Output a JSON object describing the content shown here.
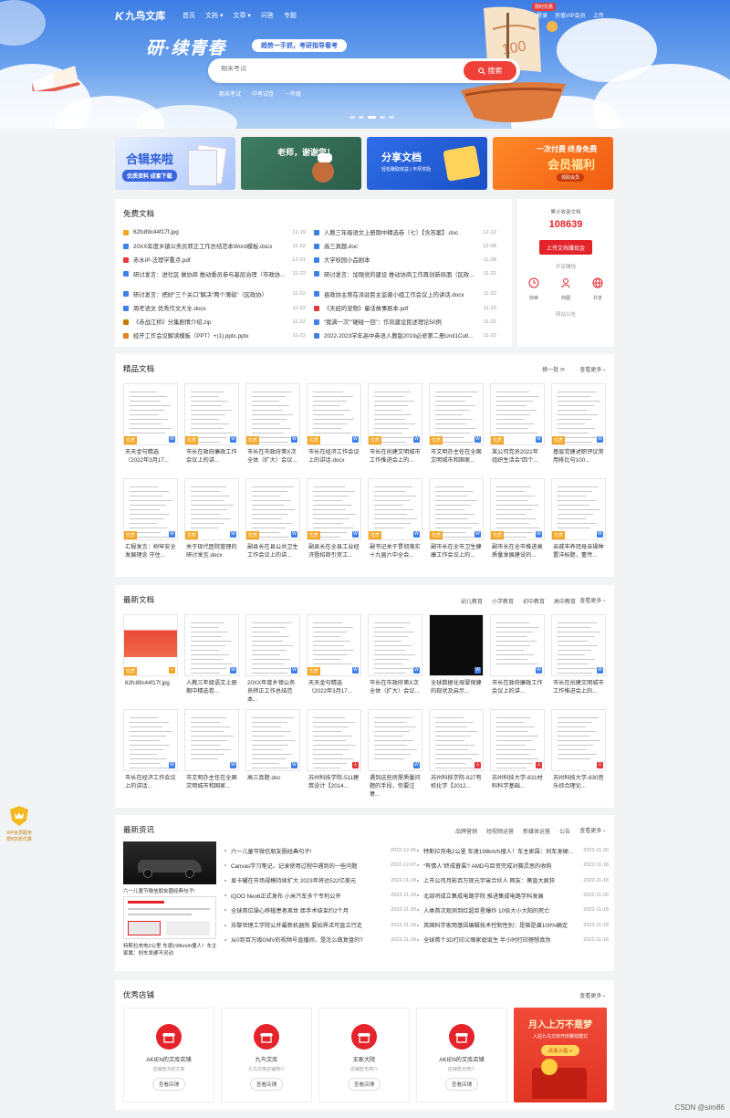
{
  "colors": {
    "accent": "#ef4138",
    "brand": "#3d7de4",
    "tag": "#f5a623"
  },
  "nav": {
    "logo": "九鸟文库",
    "links": [
      "首页",
      "文档 ▾",
      "文章 ▾",
      "问答",
      "专题"
    ],
    "vip_badge": "限时优惠",
    "right": [
      "登录",
      "充值VIP会员",
      "上传"
    ]
  },
  "hero": {
    "slogan": "研·续青春",
    "slogan2": "趋势一手抓，考研指导看考",
    "search_placeholder": "期末考试",
    "search_button": "搜索",
    "hotwords": [
      "期末考试",
      "中考试卷",
      "一年级"
    ]
  },
  "banners": [
    {
      "title": "合辑来啦",
      "sub": "优质资料 成套下载"
    },
    {
      "title": "老师，谢谢您！",
      "sub": ""
    },
    {
      "title": "分享文档",
      "sub": "轻松赚取收益 | 丰厚奖励"
    },
    {
      "title": "一次付费 终身免费",
      "sub": "会员福利",
      "btn": "领取会员"
    }
  ],
  "free": {
    "title": "免费文档",
    "left": [
      {
        "n": "62fc89c44f17f.jpg",
        "d": "12-19",
        "c": "#f5a623"
      },
      {
        "n": "20XX年度乡镇公务员转正工作总结范本Word模板.docx",
        "d": "11-22",
        "c": "#3f7fe8"
      },
      {
        "n": "赤水IP-法理学重点.pdf",
        "d": "12-01",
        "c": "#e4383b"
      },
      {
        "n": "研讨发言：进社区 做协商 推动委员参与基层治理（市政协...",
        "d": "11-22",
        "c": "#3f7fe8"
      },
      {
        "n": "研讨发言：把好“三个关口”解决“两个薄弱”（区政协）",
        "d": "11-22",
        "c": "#3f7fe8"
      },
      {
        "n": "周考语文 优秀作文大全.docx",
        "d": "11-22",
        "c": "#3f7fe8"
      },
      {
        "n": "《赤战江桥》分集剧情介绍.zip",
        "d": "11-22",
        "c": "#c47d00"
      },
      {
        "n": "经开工作会议解读模板（PPT）+(1).pptx.pptx",
        "d": "11-22",
        "c": "#e67e22"
      }
    ],
    "right": [
      {
        "n": "人教三年级语文上册期中精选卷（七）【含答案】.doc",
        "d": "12-12",
        "c": "#3f7fe8"
      },
      {
        "n": "高三真题.doc",
        "d": "12-08",
        "c": "#3f7fe8"
      },
      {
        "n": "大学校园小品剧本",
        "d": "11-28",
        "c": "#3f7fe8"
      },
      {
        "n": "研讨发言：加强党的建设 推动协商工作再创新局面（区政协...",
        "d": "11-22",
        "c": "#3f7fe8"
      },
      {
        "n": "县政协主席在派驻民主监督小组工作会议上的讲话.docx",
        "d": "11-22",
        "c": "#3f7fe8"
      },
      {
        "n": "《天经的宠物》童话故事剧本.pdf",
        "d": "11-22",
        "c": "#e4383b"
      },
      {
        "n": "“我满一次”“硬碰一回”：作风建设民述理论50例",
        "d": "11-22",
        "c": "#3f7fe8"
      },
      {
        "n": "2022-2023学年高中英语人教版2019必修第二册Unit1Cult...",
        "d": "11-22",
        "c": "#3f7fe8"
      }
    ]
  },
  "side": {
    "label": "累计收录文档",
    "count": "108639",
    "upload": "上传文档赚现金",
    "open": "开店赚钱",
    "icons": [
      "快审",
      "商圈",
      "共享"
    ],
    "notice": "网站公告"
  },
  "boutique": {
    "title": "精品文档",
    "refresh": "换一批",
    "more": "查看更多",
    "docs": [
      {
        "c": "天天金句精选（2022年3月17...",
        "t": "W"
      },
      {
        "c": "市长在政府廉政工作会议上的讲...",
        "t": "W"
      },
      {
        "c": "市长在市政府第X次全体（扩大）会议...",
        "t": "W"
      },
      {
        "c": "市长在经济工作会议上的讲话.docx",
        "t": "W"
      },
      {
        "c": "市长在创建文明城市工作推进会上的...",
        "t": "W"
      },
      {
        "c": "市文明办主任在全国文明城市和国家...",
        "t": "W"
      },
      {
        "c": "某公司党员2021年组织生活会“四个...",
        "t": "W"
      },
      {
        "c": "基层党建述职评议常用排比句100...",
        "t": "W"
      },
      {
        "c": "汇报发言：树牢安全发展理念 守住...",
        "t": "W"
      },
      {
        "c": "关于现代医院管理的研讨发言.docx",
        "t": "W"
      },
      {
        "c": "副县长在县公共卫生工作会议上的讲...",
        "t": "W"
      },
      {
        "c": "副县长在全县工业经济暨招商引资工...",
        "t": "W"
      },
      {
        "c": "副书记关于贯彻落实十九届六中全会...",
        "t": "W"
      },
      {
        "c": "副市长在全市卫生健康工作会议上的...",
        "t": "W"
      },
      {
        "c": "副市长在全市推进高质量发展建设的...",
        "t": "W"
      },
      {
        "c": "亲戚丰养冠母亲操种置洋标题，董传...",
        "t": "W"
      }
    ]
  },
  "newest": {
    "title": "最新文档",
    "tabs": [
      "幼儿教育",
      "小学教育",
      "初中教育",
      "高中教育"
    ],
    "more": "查看更多",
    "docs": [
      {
        "c": "62fc89c44f17f.jpg",
        "t": "J"
      },
      {
        "c": "人教三年级语文上册期中精选卷...",
        "t": "W"
      },
      {
        "c": "20XX年度乡镇公务员转正工作总结范本...",
        "t": "W"
      },
      {
        "c": "天天金句精选（2022年3月17...",
        "t": "W"
      },
      {
        "c": "市长在市政府第X次全体（扩大）会议...",
        "t": "W"
      },
      {
        "c": "全球数据化母婴保健的现状及启示...",
        "t": "W"
      },
      {
        "c": "市长在政府廉政工作会议上的讲...",
        "t": "W"
      },
      {
        "c": "市长在创建文明城市工作推进会上的...",
        "t": "W"
      },
      {
        "c": "市长在经济工作会议上的讲话...",
        "t": "W"
      },
      {
        "c": "市文明办主任在全国文明城市和国家...",
        "t": "W"
      },
      {
        "c": "高三真题.doc",
        "t": "W"
      },
      {
        "c": "苏州科技学院-511建筑设计【2014...",
        "t": "P"
      },
      {
        "c": "遇到这些房屋质量问题的手段，你要注意...",
        "t": "W"
      },
      {
        "c": "苏州科技学院-827有机化学【2012...",
        "t": "P"
      },
      {
        "c": "苏州科技大学-831材料科学基础...",
        "t": "P"
      },
      {
        "c": "苏州科技大学-830音乐综合理论...",
        "t": "P"
      }
    ]
  },
  "news": {
    "title": "最新资讯",
    "tabs": [
      "品牌营销",
      "短视频运营",
      "新媒体运营",
      "公告"
    ],
    "more": "查看更多",
    "img1_cap": "六一儿童节微信朋友圈经典句子!",
    "img2_cap": "特斯拉充电2公里 车速198km/h撞人！车主家属：刹车发硬不灵动",
    "left": [
      {
        "t": "六一儿童节微信朋友圈经典句子!",
        "d": "2022-12-05"
      },
      {
        "t": "Canvas学习笔记，记录使用过程中遇到的一些问题",
        "d": "2022-12-07"
      },
      {
        "t": "显卡耀在市场规模持续扩大 2023年将达522亿美元",
        "d": "2022-11-18"
      },
      {
        "t": "iQOO Neo6正式发布 小米汽车多个专利公开",
        "d": "2022-11-18"
      },
      {
        "t": "全球首位操心移植患者离世 距手术结束约2个月",
        "d": "2022-11-20"
      },
      {
        "t": "苏黎世理工学院公开最新机器狗 要如界活可直立行走",
        "d": "2022-11-18"
      },
      {
        "t": "从0到百万级GMV的视频号直播间，是怎么做复盘的?",
        "d": "2022-11-18"
      }
    ],
    "right": [
      {
        "t": "特斯拉充电2公里 车速198km/h撞人！车主家属：刹车发硬...",
        "d": "2022-11-20"
      },
      {
        "t": "“有情人”终成眷属? AMD与巨资完成对赛灵思的收购",
        "d": "2022-11-18"
      },
      {
        "t": "上市公司月影百万现元宇宙合伙人 网友：簧直大疯狂",
        "d": "2022-11-18"
      },
      {
        "t": "北部将成立集成电路学院 推进集成电路学科发展",
        "d": "2022-11-20"
      },
      {
        "t": "人类首次观测到红超巨星爆炸 10倍大小大阳的死亡",
        "d": "2022-11-18"
      },
      {
        "t": "英国科学家用基因编辑技术控制性别：是雄是雌100%确定",
        "d": "2022-11-18"
      },
      {
        "t": "全球首个3D打印义眼家庭诞生 半小时打印理想真伪",
        "d": "2022-11-18"
      }
    ]
  },
  "shops": {
    "title": "优秀店铺",
    "more": "查看更多",
    "items": [
      {
        "name": "AKIEN的文库店铺",
        "sub": "店铺暂无的文库",
        "btn": "查看店铺"
      },
      {
        "name": "九鸟文库",
        "sub": "九鸟文库店铺简介",
        "btn": "查看店铺"
      },
      {
        "name": "王家大院",
        "sub": "店铺暂无简介",
        "btn": "查看店铺"
      },
      {
        "name": "AKIEN的文库店铺",
        "sub": "店铺暂无简介",
        "btn": "查看店铺"
      }
    ],
    "promo": {
      "title": "月入上万不是梦",
      "sub": "入驻九鸟文库开启赚钱模式",
      "btn": "点击入驻 >"
    }
  },
  "vip_float": {
    "line1": "VIP会员服务",
    "line2": "限时5折优惠"
  },
  "watermark": "CSDN @sim86"
}
